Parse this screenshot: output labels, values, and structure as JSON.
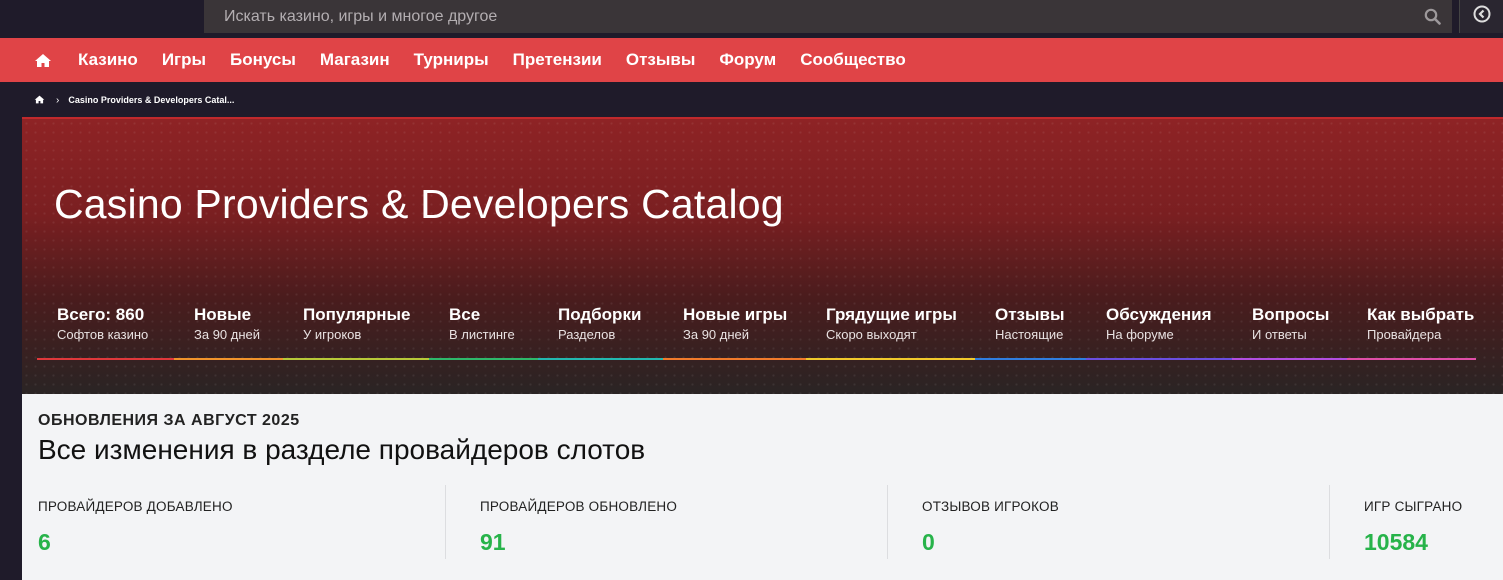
{
  "search": {
    "placeholder": "Искать казино, игры и многое другое"
  },
  "nav": {
    "items": [
      "Казино",
      "Игры",
      "Бонусы",
      "Магазин",
      "Турниры",
      "Претензии",
      "Отзывы",
      "Форум",
      "Сообщество"
    ]
  },
  "breadcrumb": {
    "current": "Casino Providers & Developers Catal..."
  },
  "hero": {
    "title": "Casino Providers & Developers Catalog",
    "stats": [
      {
        "title": "Всего: 860",
        "sub": "Софтов казино",
        "color": "#e0383b"
      },
      {
        "title": "Новые",
        "sub": "За 90 дней",
        "color": "#f0932b"
      },
      {
        "title": "Популярные",
        "sub": "У игроков",
        "color": "#b7c938"
      },
      {
        "title": "Все",
        "sub": "В листинге",
        "color": "#2eb86b"
      },
      {
        "title": "Подборки",
        "sub": "Разделов",
        "color": "#22b8b0"
      },
      {
        "title": "Новые игры",
        "sub": "За 90 дней",
        "color": "#f07a2b"
      },
      {
        "title": "Грядущие игры",
        "sub": "Скоро выходят",
        "color": "#f0c92b"
      },
      {
        "title": "Отзывы",
        "sub": "Настоящие",
        "color": "#2f7ee0"
      },
      {
        "title": "Обсуждения",
        "sub": "На форуме",
        "color": "#6a4ee0"
      },
      {
        "title": "Вопросы",
        "sub": "И ответы",
        "color": "#b24ee0"
      },
      {
        "title": "Как выбрать",
        "sub": "Провайдера",
        "color": "#e04ea8"
      }
    ]
  },
  "updates": {
    "kicker": "ОБНОВЛЕНИЯ ЗА АВГУСТ 2025",
    "title": "Все изменения в разделе провайдеров слотов",
    "counters": [
      {
        "label": "ПРОВАЙДЕРОВ ДОБАВЛЕНО",
        "value": "6"
      },
      {
        "label": "ПРОВАЙДЕРОВ ОБНОВЛЕНО",
        "value": "91"
      },
      {
        "label": "ОТЗЫВОВ ИГРОКОВ",
        "value": "0"
      },
      {
        "label": "ИГР СЫГРАНО",
        "value": "10584"
      }
    ]
  },
  "colors": {
    "nav_red": "#e04447",
    "accent_green": "#27b34a"
  },
  "icons": {
    "search": "search-icon",
    "user": "user-icon",
    "home": "home-icon"
  }
}
